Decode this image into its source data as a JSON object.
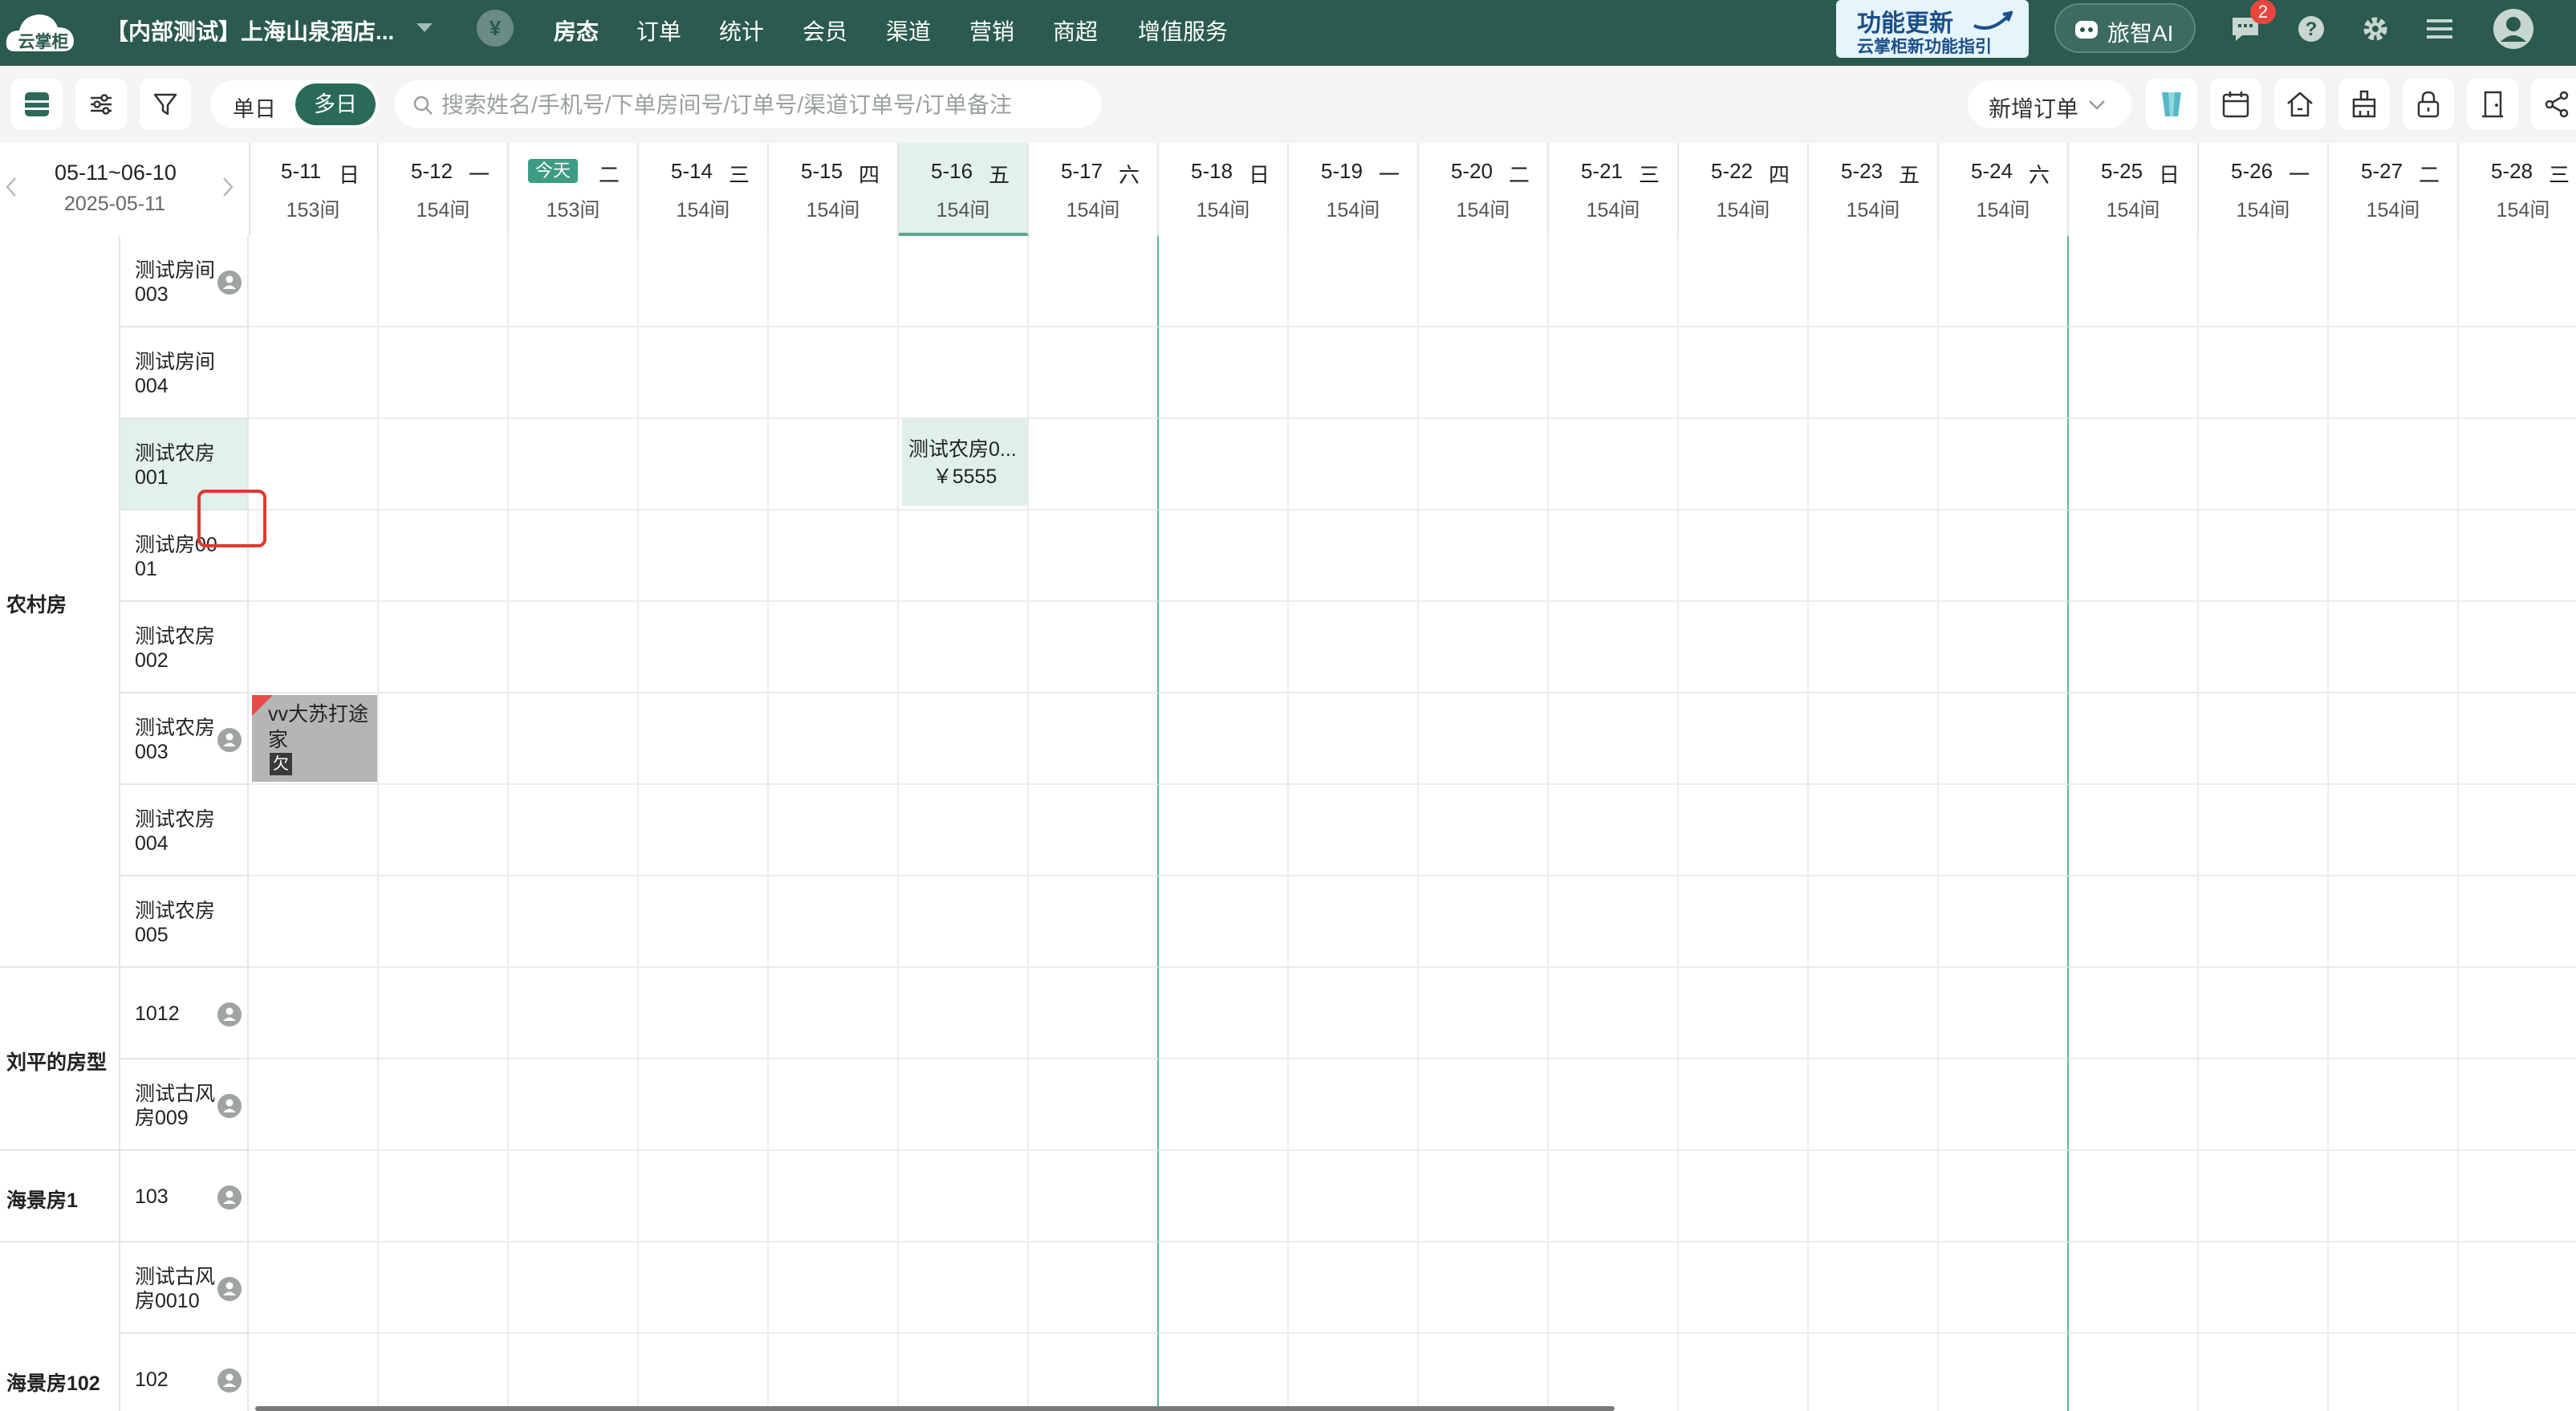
{
  "app": {
    "logo_text": "云掌柜",
    "hotel_name": "【内部测试】上海山泉酒店...",
    "nav": [
      "房态",
      "订单",
      "统计",
      "会员",
      "渠道",
      "营销",
      "商超",
      "增值服务"
    ],
    "nav_active": "房态",
    "update_title": "功能更新",
    "update_sub": "云掌柜新功能指引",
    "ai_label": "旅智AI",
    "message_count": "2"
  },
  "toolbar": {
    "single_label": "单日",
    "multi_label": "多日",
    "search_placeholder": "搜索姓名/手机号/下单房间号/订单号/渠道订单号/订单备注",
    "new_order_label": "新增订单"
  },
  "range": {
    "label": "05-11~06-10",
    "current_date": "2025-05-11"
  },
  "days": [
    {
      "date": "5-11",
      "week": "日",
      "count": "153间"
    },
    {
      "date": "5-12",
      "week": "一",
      "count": "154间"
    },
    {
      "date": "今天",
      "week": "二",
      "count": "153间",
      "today": true
    },
    {
      "date": "5-14",
      "week": "三",
      "count": "154间"
    },
    {
      "date": "5-15",
      "week": "四",
      "count": "154间"
    },
    {
      "date": "5-16",
      "week": "五",
      "count": "154间",
      "selected": true
    },
    {
      "date": "5-17",
      "week": "六",
      "count": "154间"
    },
    {
      "date": "5-18",
      "week": "日",
      "count": "154间"
    },
    {
      "date": "5-19",
      "week": "一",
      "count": "154间"
    },
    {
      "date": "5-20",
      "week": "二",
      "count": "154间"
    },
    {
      "date": "5-21",
      "week": "三",
      "count": "154间"
    },
    {
      "date": "5-22",
      "week": "四",
      "count": "154间"
    },
    {
      "date": "5-23",
      "week": "五",
      "count": "154间"
    },
    {
      "date": "5-24",
      "week": "六",
      "count": "154间"
    },
    {
      "date": "5-25",
      "week": "日",
      "count": "154间"
    },
    {
      "date": "5-26",
      "week": "一",
      "count": "154间"
    },
    {
      "date": "5-27",
      "week": "二",
      "count": "154间"
    },
    {
      "date": "5-28",
      "week": "三",
      "count": "154间"
    }
  ],
  "room_types": [
    {
      "name": "农村房"
    },
    {
      "name": "刘平的房型"
    },
    {
      "name": "海景房1"
    },
    {
      "name": "海景房102"
    }
  ],
  "rooms": [
    {
      "name": "测试房间003",
      "icon": true
    },
    {
      "name": "测试房间004",
      "icon": false
    },
    {
      "name": "测试农房001",
      "icon": false,
      "highlight": true
    },
    {
      "name": "测试房0001",
      "icon": false
    },
    {
      "name": "测试农房002",
      "icon": false
    },
    {
      "name": "测试农房003",
      "icon": true
    },
    {
      "name": "测试农房004",
      "icon": false
    },
    {
      "name": "测试农房005",
      "icon": false
    },
    {
      "name": "1012",
      "icon": true
    },
    {
      "name": "测试古风房009",
      "icon": true
    },
    {
      "name": "103",
      "icon": true
    },
    {
      "name": "测试古风房0010",
      "icon": true
    },
    {
      "name": "102",
      "icon": true
    }
  ],
  "bookings": [
    {
      "name": "测试农房0...",
      "price": "￥5555"
    },
    {
      "name": "vv大苏打途家",
      "badge": "欠"
    }
  ]
}
